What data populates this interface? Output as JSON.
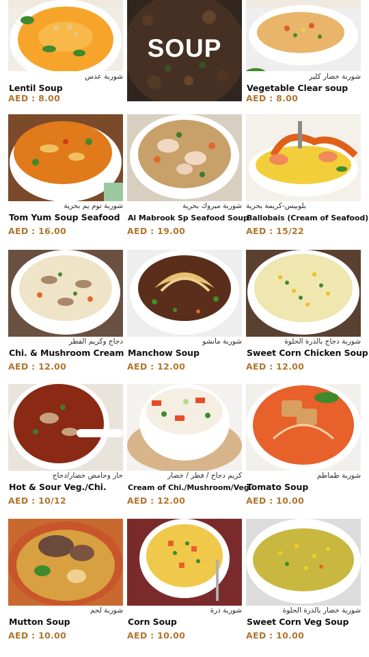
{
  "banner": {
    "title": "SOUP"
  },
  "items": [
    {
      "ar": "شوربة عدس",
      "en": "Lentil Soup",
      "price": "AED : 8.00"
    },
    {
      "ar": "شوربة خضار كلير",
      "en": "Vegetable Clear soup",
      "price": "AED : 8.00"
    },
    {
      "ar": "شوربة توم يم بحرية",
      "en": "Tom Yum Soup Seafood",
      "price": "AED : 16.00"
    },
    {
      "ar": "شوربة مبروك بحرية",
      "en": "Al Mabrook Sp Seafood Soup",
      "price": "AED : 19.00"
    },
    {
      "ar": "بلوبيس-كريمة بحرية",
      "en": "Ballobais (Cream of Seafood)",
      "price": "AED : 15/22"
    },
    {
      "ar": "دجاج وكريم الفطر",
      "en": "Chi. & Mushroom Cream",
      "price": "AED : 12.00"
    },
    {
      "ar": "شوربة مانشو",
      "en": "Manchow Soup",
      "price": "AED : 12.00"
    },
    {
      "ar": "شوربة دجاج بالذرة الحلوة",
      "en": "Sweet Corn Chicken Soup",
      "price": "AED : 12.00"
    },
    {
      "ar": "حار وحامض خضار/دجاج",
      "en": "Hot & Sour Veg./Chi.",
      "price": "AED : 10/12"
    },
    {
      "ar": "كريم دجاج / فطر / خضار",
      "en": "Cream of Chi./Mushroom/Veg.",
      "price": "AED : 12.00"
    },
    {
      "ar": "شوربة طماطم",
      "en": "Tomato Soup",
      "price": "AED : 10.00"
    },
    {
      "ar": "شوربة لحم",
      "en": "Mutton Soup",
      "price": "AED : 10.00"
    },
    {
      "ar": "شوربة ذرة",
      "en": "Corn Soup",
      "price": "AED : 10.00"
    },
    {
      "ar": "شوربة خضار بالذرة الحلوة",
      "en": "Sweet Corn Veg Soup",
      "price": "AED : 10.00"
    }
  ],
  "colors": {
    "price": "#b2752d",
    "text": "#111111",
    "background": "#ffffff"
  }
}
